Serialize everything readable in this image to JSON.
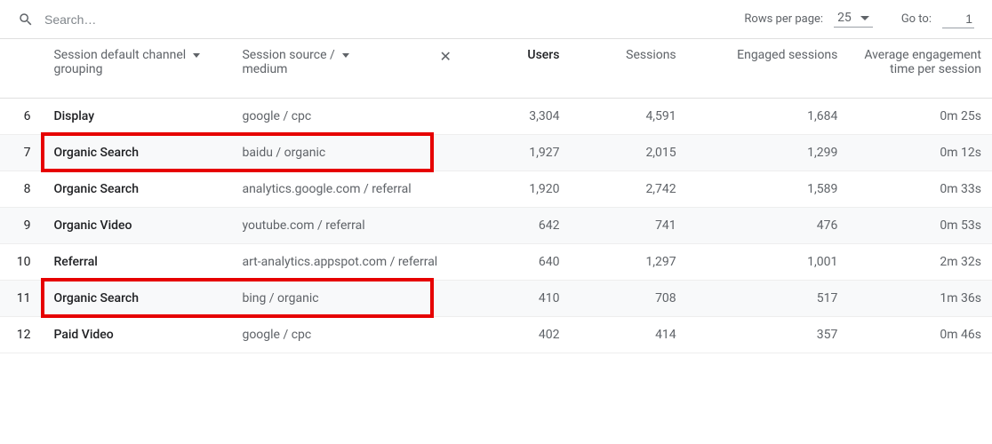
{
  "toolbar": {
    "search_placeholder": "Search…",
    "rows_per_page_label": "Rows per page:",
    "rows_per_page_value": "25",
    "goto_label": "Go to:",
    "goto_value": "1"
  },
  "headers": {
    "channel_grouping": "Session default channel grouping",
    "source_medium": "Session source / medium",
    "users": "Users",
    "sessions": "Sessions",
    "engaged_sessions": "Engaged sessions",
    "avg_engagement": "Average engagement time per session"
  },
  "rows": [
    {
      "idx": "6",
      "channel": "Display",
      "source": "google / cpc",
      "users": "3,304",
      "sessions": "4,591",
      "engaged": "1,684",
      "aet": "0m 25s",
      "hl": false
    },
    {
      "idx": "7",
      "channel": "Organic Search",
      "source": "baidu / organic",
      "users": "1,927",
      "sessions": "2,015",
      "engaged": "1,299",
      "aet": "0m 12s",
      "hl": true
    },
    {
      "idx": "8",
      "channel": "Organic Search",
      "source": "analytics.google.com / referral",
      "users": "1,920",
      "sessions": "2,742",
      "engaged": "1,589",
      "aet": "0m 33s",
      "hl": false
    },
    {
      "idx": "9",
      "channel": "Organic Video",
      "source": "youtube.com / referral",
      "users": "642",
      "sessions": "741",
      "engaged": "476",
      "aet": "0m 53s",
      "hl": false
    },
    {
      "idx": "10",
      "channel": "Referral",
      "source": "art-analytics.appspot.com / referral",
      "users": "640",
      "sessions": "1,297",
      "engaged": "1,001",
      "aet": "2m 32s",
      "hl": false
    },
    {
      "idx": "11",
      "channel": "Organic Search",
      "source": "bing / organic",
      "users": "410",
      "sessions": "708",
      "engaged": "517",
      "aet": "1m 36s",
      "hl": true
    },
    {
      "idx": "12",
      "channel": "Paid Video",
      "source": "google / cpc",
      "users": "402",
      "sessions": "414",
      "engaged": "357",
      "aet": "0m 46s",
      "hl": false
    }
  ]
}
